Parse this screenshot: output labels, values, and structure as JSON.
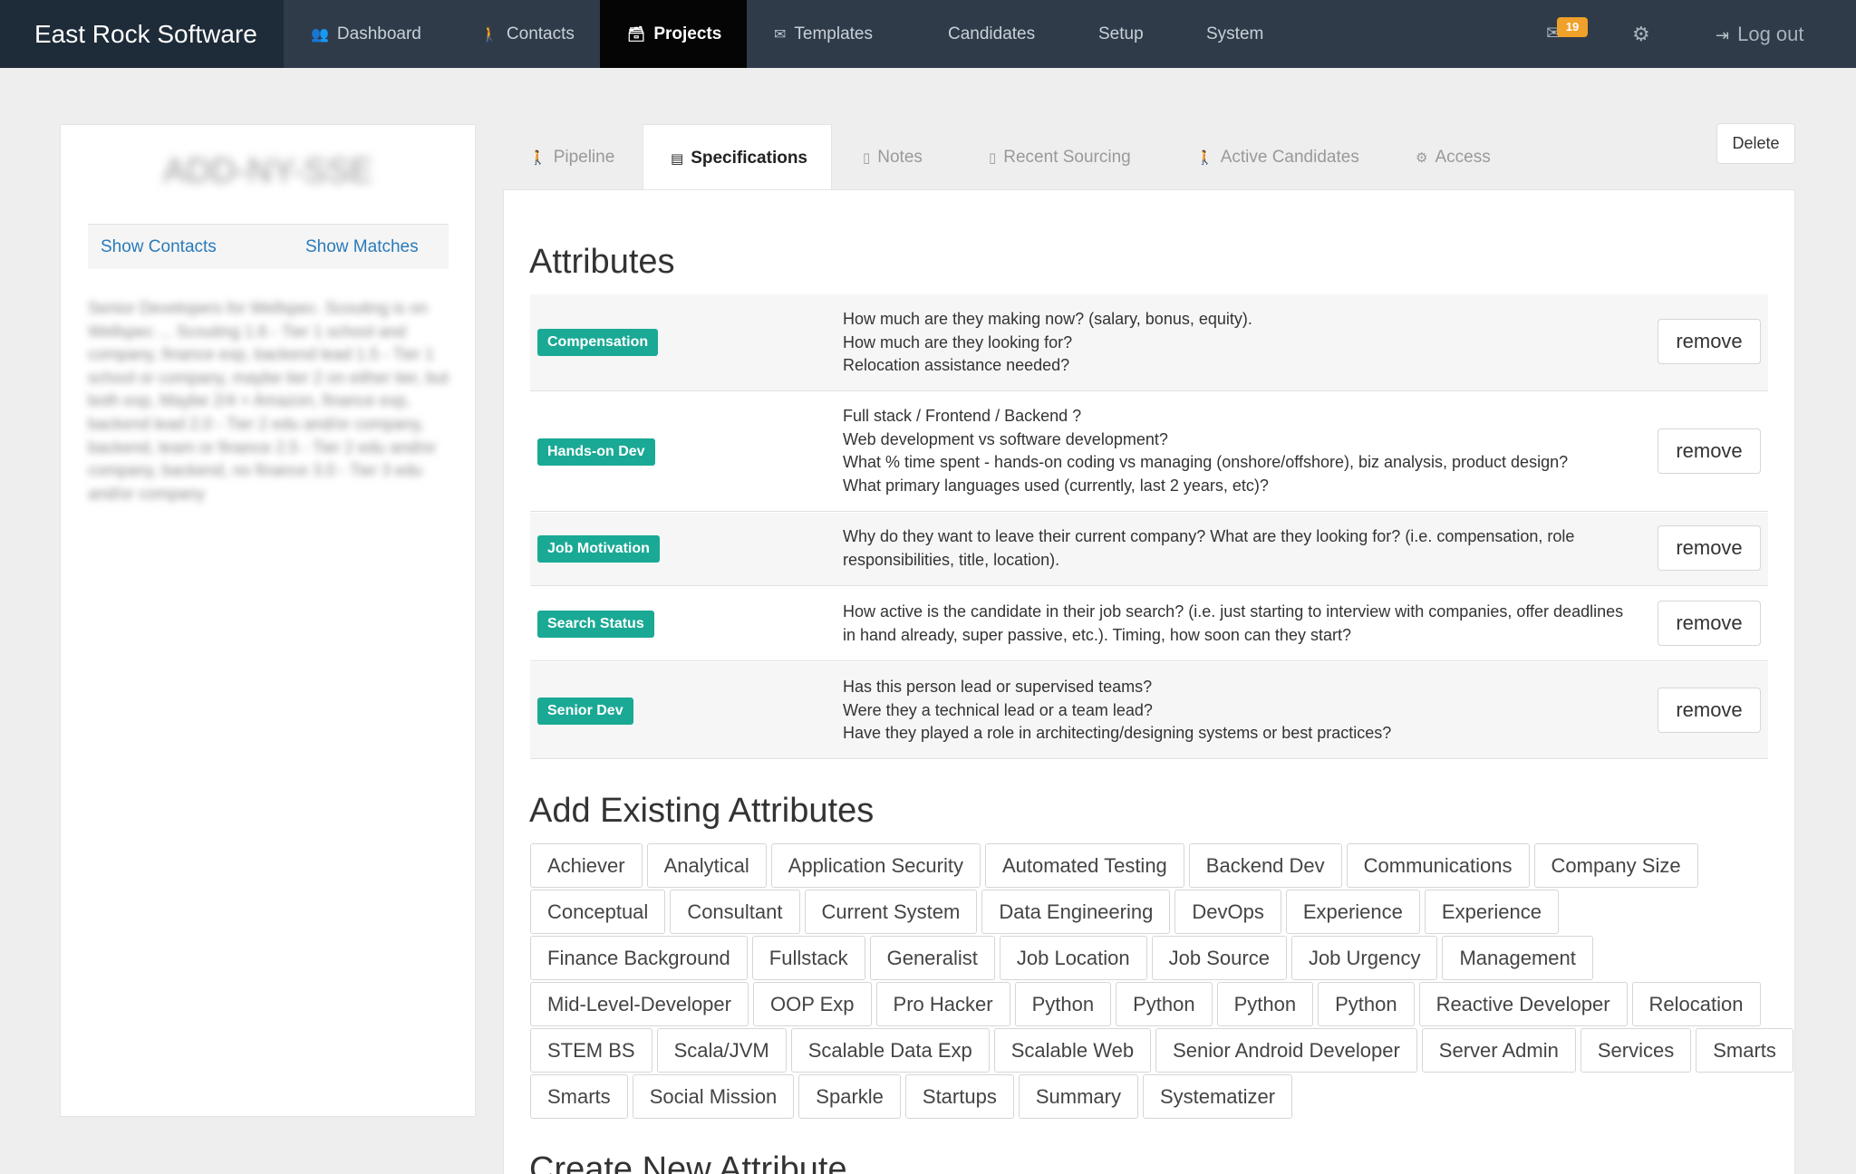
{
  "navbar": {
    "brand": "East Rock Software",
    "items": [
      {
        "label": "Dashboard",
        "icon": "users-icon",
        "glyph": "👥"
      },
      {
        "label": "Contacts",
        "icon": "person-icon",
        "glyph": "🚶"
      },
      {
        "label": "Projects",
        "icon": "archive-icon",
        "glyph": "🗃"
      },
      {
        "label": "Templates",
        "icon": "envelope-icon",
        "glyph": "✉"
      },
      {
        "label": "Candidates"
      },
      {
        "label": "Setup"
      },
      {
        "label": "System"
      }
    ],
    "mail_count": "19",
    "logout_label": "Log out"
  },
  "left_panel": {
    "project_title": "ADD-NY-SSE",
    "show_contacts": "Show Contacts",
    "show_matches": "Show Matches",
    "description": "Senior Developers for Wellspec. Scouting is on Wellspec ... Scouting 1.6 - Tier 1 school and company, finance exp, backend lead 1.5 - Tier 1 school or company, maybe tier 2 on either tier, but both exp, Maybe 2/4 + Amazon, finance exp, backend lead 2.0 - Tier 2 edu and/or company, backend, team or finance 2.5 - Tier 2 edu and/or company, backend, no finance 3.0 - Tier 3 edu and/or company"
  },
  "tabs": [
    {
      "label": "Pipeline",
      "glyph": "🚶"
    },
    {
      "label": "Specifications",
      "glyph": "▤"
    },
    {
      "label": "Notes",
      "glyph": "▯"
    },
    {
      "label": "Recent Sourcing",
      "glyph": "▯"
    },
    {
      "label": "Active Candidates",
      "glyph": "🚶"
    },
    {
      "label": "Access",
      "glyph": "⚙"
    }
  ],
  "delete_label": "Delete",
  "attributes": {
    "title": "Attributes",
    "remove_label": "remove",
    "rows": [
      {
        "tag": "Compensation",
        "lines": [
          "How much are they making now? (salary, bonus, equity).",
          "How much are they looking for?",
          "Relocation assistance needed?"
        ]
      },
      {
        "tag": "Hands-on Dev",
        "lines": [
          "Full stack / Frontend / Backend ?",
          "Web development vs software development?",
          "What % time spent - hands-on coding vs managing (onshore/offshore), biz analysis, product design?",
          "What primary languages used (currently, last 2 years, etc)?"
        ]
      },
      {
        "tag": "Job Motivation",
        "lines": [
          "Why do they want to leave their current company? What are they looking for? (i.e. compensation, role responsibilities, title, location)."
        ]
      },
      {
        "tag": "Search Status",
        "lines": [
          "How active is the candidate in their job search? (i.e. just starting to interview with companies, offer deadlines in hand already, super passive, etc.). Timing, how soon can they start?"
        ]
      },
      {
        "tag": "Senior Dev",
        "lines": [
          "Has this person lead or supervised teams?",
          "Were they a technical lead or a team lead?",
          "Have they played a role in architecting/designing systems or best practices?"
        ]
      }
    ]
  },
  "add_existing": {
    "title": "Add Existing Attributes",
    "rows": [
      [
        "Achiever",
        "Analytical",
        "Application Security",
        "Automated Testing",
        "Backend Dev",
        "Communications",
        "Company Size"
      ],
      [
        "Conceptual",
        "Consultant",
        "Current System",
        "Data Engineering",
        "DevOps",
        "Experience",
        "Experience"
      ],
      [
        "Finance Background",
        "Fullstack",
        "Generalist",
        "Job Location",
        "Job Source",
        "Job Urgency",
        "Management"
      ],
      [
        "Mid-Level-Developer",
        "OOP Exp",
        "Pro Hacker",
        "Python",
        "Python",
        "Python",
        "Python",
        "Reactive Developer",
        "Relocation"
      ],
      [
        "STEM BS",
        "Scala/JVM",
        "Scalable Data Exp",
        "Scalable Web",
        "Senior Android Developer",
        "Server Admin",
        "Services",
        "Smarts"
      ],
      [
        "Smarts",
        "Social Mission",
        "Sparkle",
        "Startups",
        "Summary",
        "Systematizer"
      ]
    ]
  },
  "create_new": {
    "title": "Create New Attribute"
  },
  "colors": {
    "navbar": "#2f3b49",
    "brand_bg": "#1e2b38",
    "active_nav": "#050505",
    "tag_green": "#1aa995",
    "badge_orange": "#f0a12a",
    "link_blue": "#2a7ab8"
  }
}
